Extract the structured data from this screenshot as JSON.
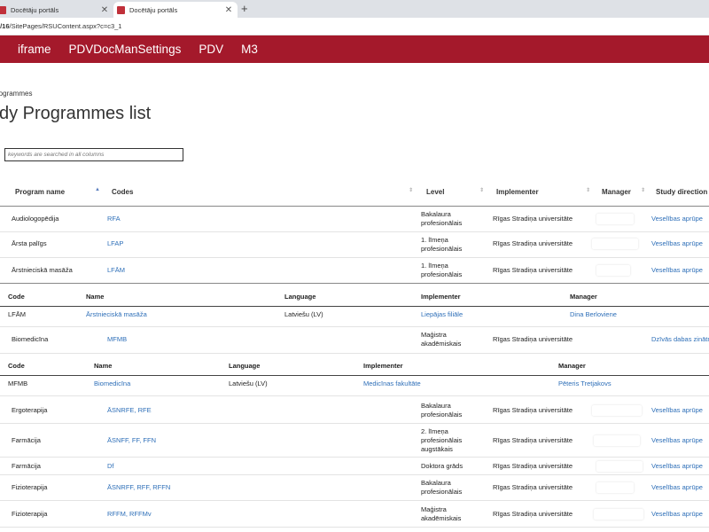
{
  "browser": {
    "tabs": [
      {
        "title": "Docētāju portāls",
        "active": false
      },
      {
        "title": "Docētāju portāls",
        "active": true
      }
    ],
    "url_prefix": "i/16",
    "url_rest": "/SitePages/RSUContent.aspx?c=c3_1"
  },
  "nav": {
    "items": [
      "iframe",
      "PDVDocManSettings",
      "PDV",
      "M3"
    ],
    "color": "#a4192b"
  },
  "breadcrumb": "rogrammes",
  "page_title": "dy Programmes list",
  "search": {
    "placeholder": "keywords are searched in all columns",
    "value": ""
  },
  "table": {
    "headers": {
      "program": "Program name",
      "codes": "Codes",
      "level": "Level",
      "implementer": "Implementer",
      "manager": "Manager",
      "direction": "Study direction"
    },
    "rows": [
      {
        "name": "Audiologopēdija",
        "codes": "RFA",
        "level": [
          "Bakalaura",
          "profesionālais"
        ],
        "implementer": "Rīgas Stradiņa universitāte",
        "direction": "Veselības aprūpe"
      },
      {
        "name": "Ārsta palīgs",
        "codes": "LFAP",
        "level": [
          "1. līmeņa",
          "profesionālais"
        ],
        "implementer": "Rīgas Stradiņa universitāte",
        "direction": "Veselības aprūpe"
      },
      {
        "name": "Ārstnieciskā masāža",
        "codes": "LFĀM",
        "level": [
          "1. līmeņa",
          "profesionālais"
        ],
        "implementer": "Rīgas Stradiņa universitāte",
        "direction": "Veselības aprūpe"
      },
      {
        "name": "Biomedicīna",
        "codes": "MFMB",
        "level": [
          "Maģistra",
          "akadēmiskais"
        ],
        "implementer": "Rīgas Stradiņa universitāte",
        "direction": "Dzīvās dabas zinātn"
      },
      {
        "name": "Ergoterapija",
        "codes": "ĀSNRFE, RFE",
        "level": [
          "Bakalaura",
          "profesionālais"
        ],
        "implementer": "Rīgas Stradiņa universitāte",
        "direction": "Veselības aprūpe"
      },
      {
        "name": "Farmācija",
        "codes": "ĀSNFF, FF, FFN",
        "level": [
          "2. līmeņa",
          "profesionālais",
          "augstākais"
        ],
        "implementer": "Rīgas Stradiņa universitāte",
        "direction": "Veselības aprūpe"
      },
      {
        "name": "Farmācija",
        "codes": "Df",
        "level": [
          "Doktora grāds"
        ],
        "implementer": "Rīgas Stradiņa universitāte",
        "direction": "Veselības aprūpe"
      },
      {
        "name": "Fizioterapija",
        "codes": "ĀSNRFF, RFF, RFFN",
        "level": [
          "Bakalaura",
          "profesionālais"
        ],
        "implementer": "Rīgas Stradiņa universitāte",
        "direction": "Veselības aprūpe"
      },
      {
        "name": "Fizioterapija",
        "codes": "RFFM, RFFMv",
        "level": [
          "Maģistra",
          "akadēmiskais"
        ],
        "implementer": "Rīgas Stradiņa universitāte",
        "direction": "Veselības aprūpe"
      }
    ]
  },
  "subtables": [
    {
      "headers": {
        "code": "Code",
        "name": "Name",
        "language": "Language",
        "implementer": "Implementer",
        "manager": "Manager"
      },
      "row": {
        "code": "LFĀM",
        "name": "Ārstnieciskā masāža",
        "language": "Latviešu (LV)",
        "implementer": "Liepājas filiāle",
        "manager": "Dina Berloviene"
      }
    },
    {
      "headers": {
        "code": "Code",
        "name": "Name",
        "language": "Language",
        "implementer": "Implementer",
        "manager": "Manager"
      },
      "row": {
        "code": "MFMB",
        "name": "Biomedicīna",
        "language": "Latviešu (LV)",
        "implementer": "Medicīnas fakultāte",
        "manager": "Pēteris Tretjakovs"
      }
    }
  ]
}
